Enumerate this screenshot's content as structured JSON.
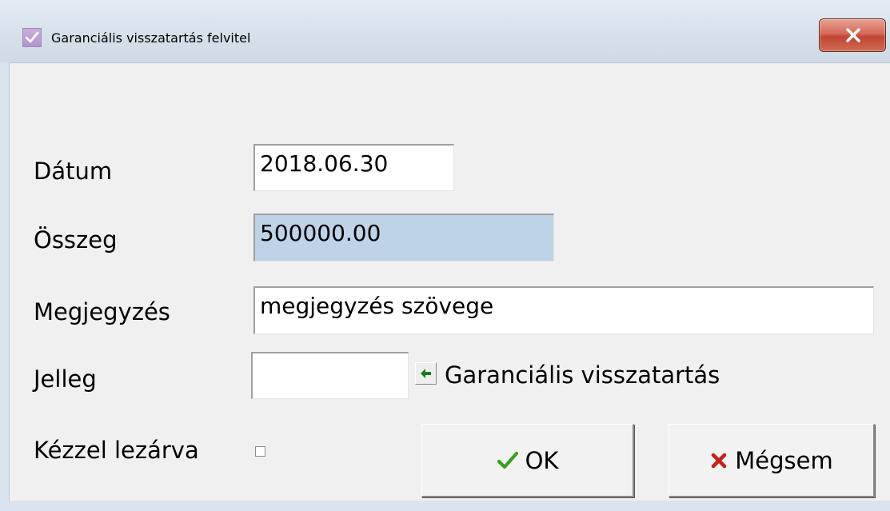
{
  "window": {
    "title": "Garanciális visszatartás felvitel"
  },
  "form": {
    "datum": {
      "label": "Dátum",
      "value": "2018.06.30"
    },
    "osszeg": {
      "label": "Összeg",
      "value": "500000.00"
    },
    "megjegyzes": {
      "label": "Megjegyzés",
      "value": "megjegyzés szövege"
    },
    "jelleg": {
      "label": "Jelleg",
      "value": "",
      "lookup_text": "Garanciális visszatartás"
    },
    "kezzel_lezarva": {
      "label": "Kézzel lezárva",
      "checked": false
    }
  },
  "buttons": {
    "ok": "OK",
    "cancel": "Mégsem"
  },
  "colors": {
    "readonly_field": "#bfd3e8",
    "ok_check": "#3aa01e",
    "cancel_x": "#c42318",
    "close_button": "#c94a36"
  },
  "icons": {
    "app": "checkmark-icon",
    "close": "close-icon",
    "lookup": "arrow-left-icon",
    "ok": "checkmark-icon",
    "cancel": "x-icon"
  }
}
